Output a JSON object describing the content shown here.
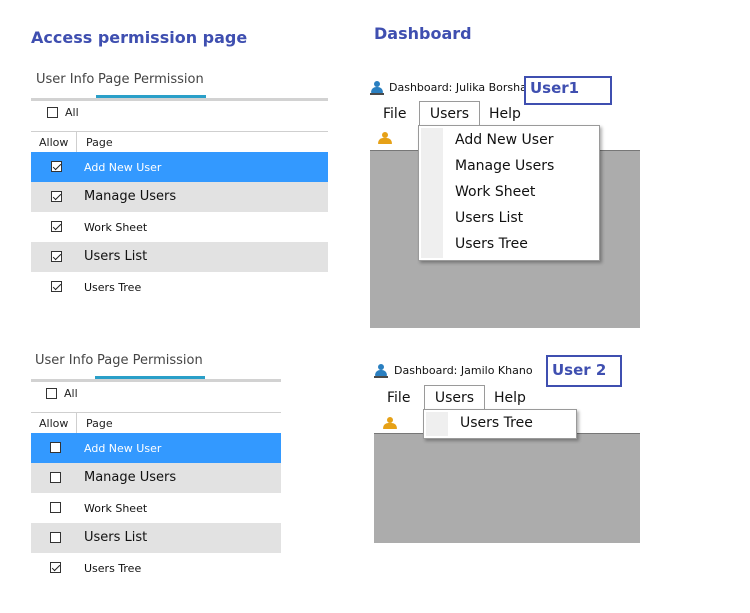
{
  "headings": {
    "left": "Access permission page",
    "right": "Dashboard"
  },
  "panels": [
    {
      "tabs": [
        "User Info",
        "Page Permission"
      ],
      "all_label": "All",
      "all_checked": false,
      "columns": [
        "Allow",
        "Page"
      ],
      "rows": [
        {
          "label": "Add New User",
          "checked": true,
          "style": "selected"
        },
        {
          "label": "Manage Users",
          "checked": true,
          "style": "alt"
        },
        {
          "label": "Work Sheet",
          "checked": true,
          "style": "normal"
        },
        {
          "label": "Users List",
          "checked": true,
          "style": "alt"
        },
        {
          "label": "Users Tree",
          "checked": true,
          "style": "normal"
        }
      ]
    },
    {
      "tabs": [
        "User Info",
        "Page Permission"
      ],
      "all_label": "All",
      "all_checked": false,
      "columns": [
        "Allow",
        "Page"
      ],
      "rows": [
        {
          "label": "Add New User",
          "checked": false,
          "style": "selected"
        },
        {
          "label": "Manage Users",
          "checked": false,
          "style": "alt"
        },
        {
          "label": "Work Sheet",
          "checked": false,
          "style": "normal"
        },
        {
          "label": "Users List",
          "checked": false,
          "style": "alt"
        },
        {
          "label": "Users Tree",
          "checked": true,
          "style": "normal"
        }
      ]
    }
  ],
  "dashboards": [
    {
      "title": "Dashboard: Julika Borsha",
      "badge": "User1",
      "menu": [
        "File",
        "Users",
        "Help"
      ],
      "dropdown": [
        "Add New User",
        "Manage Users",
        "Work Sheet",
        "Users List",
        "Users Tree"
      ]
    },
    {
      "title": "Dashboard: Jamilo Khano",
      "badge": "User 2",
      "menu": [
        "File",
        "Users",
        "Help"
      ],
      "dropdown": [
        "Users Tree"
      ]
    }
  ],
  "icons": {
    "window": "user-icon",
    "toolbar": "user-icon-orange"
  },
  "colors": {
    "accent": "#3f4fb0",
    "selected_row": "#3399ff",
    "tab_underline": "#2a9fc8",
    "content_area": "#acacac"
  }
}
